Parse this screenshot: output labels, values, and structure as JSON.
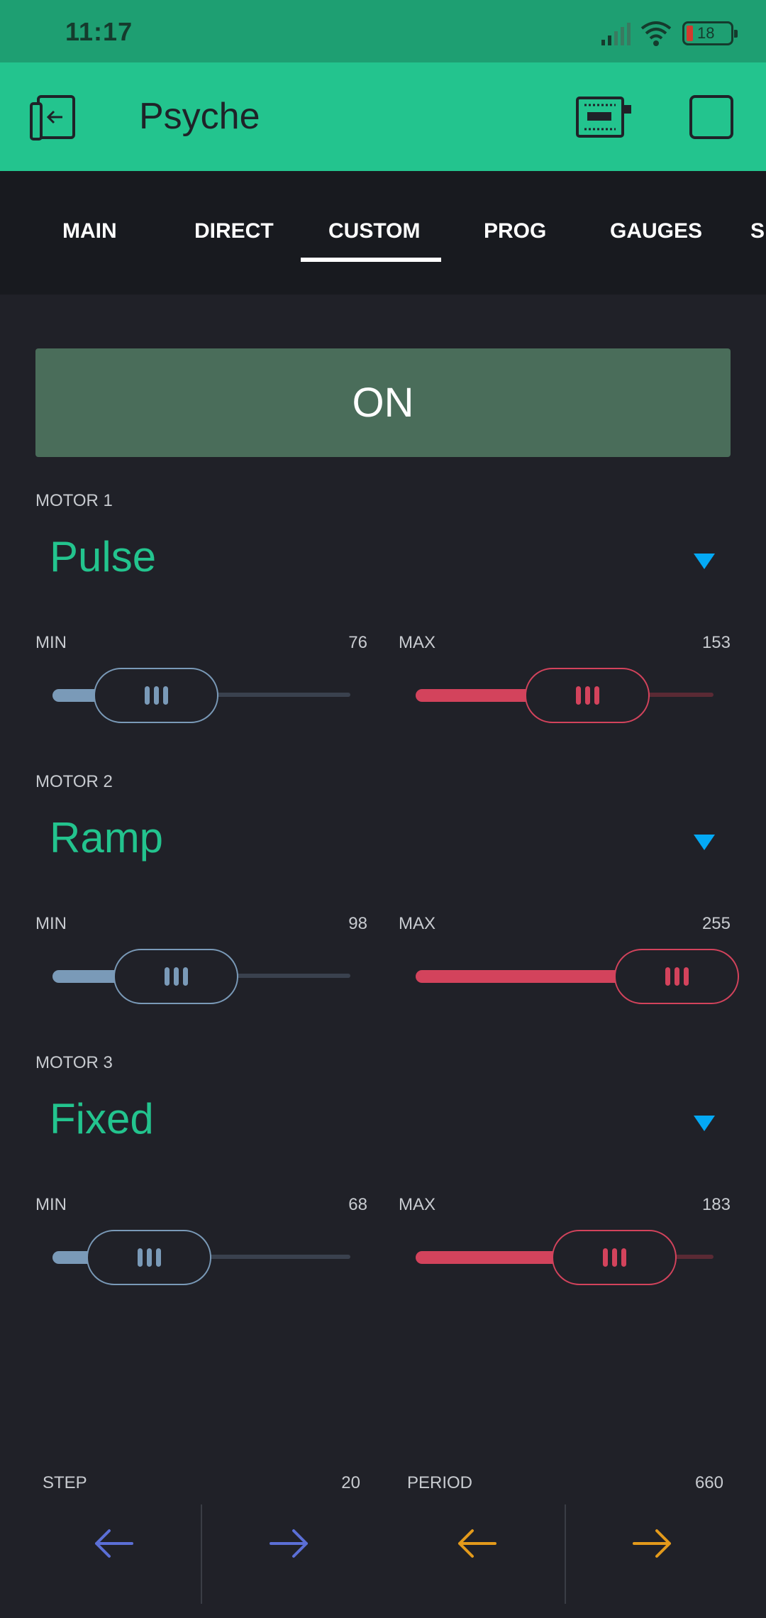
{
  "status_bar": {
    "time": "11:17",
    "battery": "18"
  },
  "header": {
    "title": "Psyche"
  },
  "tabs": [
    "MAIN",
    "DIRECT",
    "CUSTOM",
    "PROG",
    "GAUGES",
    "SE"
  ],
  "active_tab": "CUSTOM",
  "power_button": {
    "label": "ON"
  },
  "motors": [
    {
      "label": "MOTOR 1",
      "mode": "Pulse",
      "min_label": "MIN",
      "min_value": "76",
      "max_label": "MAX",
      "max_value": "153"
    },
    {
      "label": "MOTOR 2",
      "mode": "Ramp",
      "min_label": "MIN",
      "min_value": "98",
      "max_label": "MAX",
      "max_value": "255"
    },
    {
      "label": "MOTOR 3",
      "mode": "Fixed",
      "min_label": "MIN",
      "min_value": "68",
      "max_label": "MAX",
      "max_value": "183"
    }
  ],
  "step": {
    "label": "STEP",
    "value": "20"
  },
  "period": {
    "label": "PERIOD",
    "value": "660"
  },
  "colors": {
    "status_bar": "#1e9f72",
    "header": "#23c48e",
    "accent_green": "#23c48e",
    "on_button": "#4a6d5a",
    "slider_min": "#7a9ab8",
    "slider_max": "#d3435c",
    "dropdown_arrow": "#04a9f4",
    "step_arrow": "#5b6fd6",
    "period_arrow": "#e39a1b"
  },
  "icons": {
    "back": "back-icon",
    "device": "device-icon",
    "menu": "square-icon",
    "left": "arrow-left-icon",
    "right": "arrow-right-icon"
  }
}
